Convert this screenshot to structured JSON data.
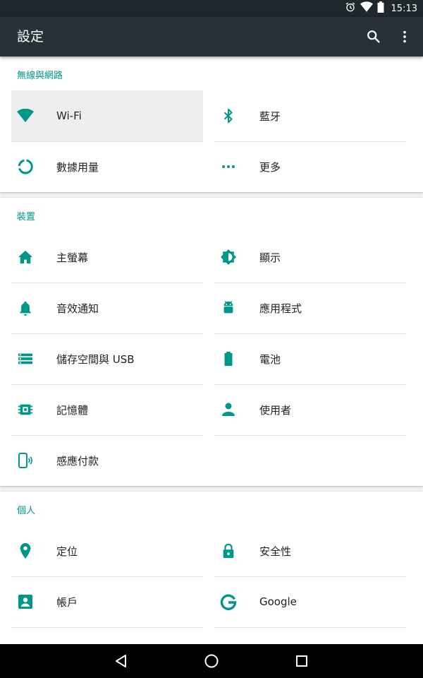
{
  "status_bar": {
    "time": "15:13",
    "icons": [
      "alarm-icon",
      "wifi-icon",
      "battery-icon"
    ]
  },
  "app_bar": {
    "title": "設定",
    "actions": [
      "search-icon",
      "more-vert-icon"
    ]
  },
  "colors": {
    "accent": "#009688",
    "app_bar": "#263238",
    "status_bar": "#1e272c"
  },
  "sections": [
    {
      "title": "無線與網路",
      "items": [
        {
          "label": "Wi-Fi",
          "icon": "wifi-icon",
          "selected": true
        },
        {
          "label": "藍牙",
          "icon": "bluetooth-icon"
        },
        {
          "label": "數據用量",
          "icon": "data-usage-icon"
        },
        {
          "label": "更多",
          "icon": "more-horiz-icon"
        }
      ]
    },
    {
      "title": "裝置",
      "items": [
        {
          "label": "主螢幕",
          "icon": "home-icon"
        },
        {
          "label": "顯示",
          "icon": "brightness-icon"
        },
        {
          "label": "音效通知",
          "icon": "bell-icon"
        },
        {
          "label": "應用程式",
          "icon": "android-icon"
        },
        {
          "label": "儲存空間與 USB",
          "icon": "storage-icon"
        },
        {
          "label": "電池",
          "icon": "battery-icon"
        },
        {
          "label": "記憶體",
          "icon": "memory-icon"
        },
        {
          "label": "使用者",
          "icon": "person-icon"
        },
        {
          "label": "感應付款",
          "icon": "tap-pay-icon"
        }
      ]
    },
    {
      "title": "個人",
      "items": [
        {
          "label": "定位",
          "icon": "location-icon"
        },
        {
          "label": "安全性",
          "icon": "lock-icon"
        },
        {
          "label": "帳戶",
          "icon": "account-box-icon"
        },
        {
          "label": "Google",
          "icon": "google-icon"
        }
      ]
    }
  ],
  "nav_bar": [
    "back-icon",
    "home-circle-icon",
    "recents-icon"
  ]
}
